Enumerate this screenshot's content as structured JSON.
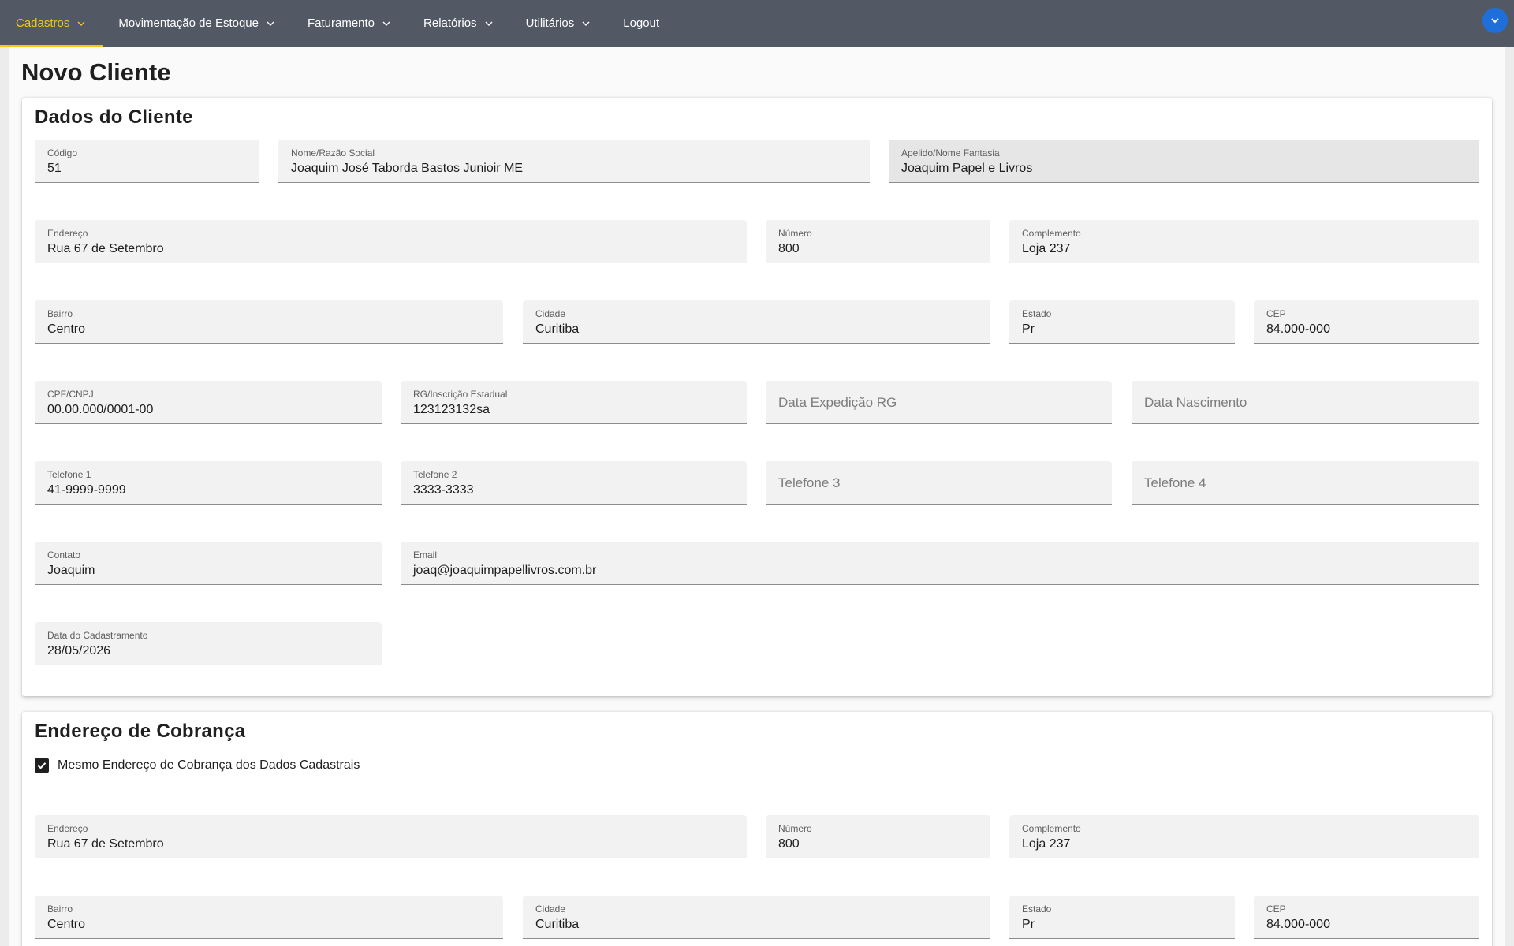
{
  "nav": {
    "items": [
      {
        "label": "Cadastros",
        "has_menu": true,
        "active": true
      },
      {
        "label": "Movimentação de Estoque",
        "has_menu": true
      },
      {
        "label": "Faturamento",
        "has_menu": true
      },
      {
        "label": "Relatórios",
        "has_menu": true
      },
      {
        "label": "Utilitários",
        "has_menu": true
      },
      {
        "label": "Logout",
        "has_menu": false
      }
    ],
    "accent_color": "#f5c518",
    "bar_color": "#525964",
    "account_button_color": "#1e6fd9"
  },
  "page": {
    "title": "Novo Cliente"
  },
  "dados": {
    "title": "Dados do Cliente",
    "codigo": {
      "label": "Código",
      "value": "51"
    },
    "nome": {
      "label": "Nome/Razão Social",
      "value": "Joaquim José Taborda Bastos Junioir ME"
    },
    "apelido": {
      "label": "Apelido/Nome Fantasia",
      "value": "Joaquim Papel e Livros"
    },
    "endereco": {
      "label": "Endereço",
      "value": "Rua 67 de Setembro"
    },
    "numero": {
      "label": "Número",
      "value": "800"
    },
    "complemento": {
      "label": "Complemento",
      "value": "Loja 237"
    },
    "bairro": {
      "label": "Bairro",
      "value": "Centro"
    },
    "cidade": {
      "label": "Cidade",
      "value": "Curitiba"
    },
    "estado": {
      "label": "Estado",
      "value": "Pr"
    },
    "cep": {
      "label": "CEP",
      "value": "84.000-000"
    },
    "cpf": {
      "label": "CPF/CNPJ",
      "value": "00.00.000/0001-00"
    },
    "rg": {
      "label": "RG/Inscrição Estadual",
      "value": "123123132sa"
    },
    "data_exp_rg": {
      "placeholder": "Data Expedição RG"
    },
    "data_nasc": {
      "placeholder": "Data Nascimento"
    },
    "tel1": {
      "label": "Telefone 1",
      "value": "41-9999-9999"
    },
    "tel2": {
      "label": "Telefone 2",
      "value": "3333-3333"
    },
    "tel3": {
      "placeholder": "Telefone 3"
    },
    "tel4": {
      "placeholder": "Telefone 4"
    },
    "contato": {
      "label": "Contato",
      "value": "Joaquim"
    },
    "email": {
      "label": "Email",
      "value": "joaq@joaquimpapellivros.com.br"
    },
    "data_cad": {
      "label": "Data do Cadastramento",
      "value": "28/05/2026"
    }
  },
  "cobranca": {
    "title": "Endereço de Cobrança",
    "same_address": {
      "label": "Mesmo Endereço de Cobrança dos Dados Cadastrais",
      "checked": true
    },
    "endereco": {
      "label": "Endereço",
      "value": "Rua 67 de Setembro"
    },
    "numero": {
      "label": "Número",
      "value": "800"
    },
    "complemento": {
      "label": "Complemento",
      "value": "Loja 237"
    },
    "bairro": {
      "label": "Bairro",
      "value": "Centro"
    },
    "cidade": {
      "label": "Cidade",
      "value": "Curitiba"
    },
    "estado": {
      "label": "Estado",
      "value": "Pr"
    },
    "cep": {
      "label": "CEP",
      "value": "84.000-000"
    }
  }
}
